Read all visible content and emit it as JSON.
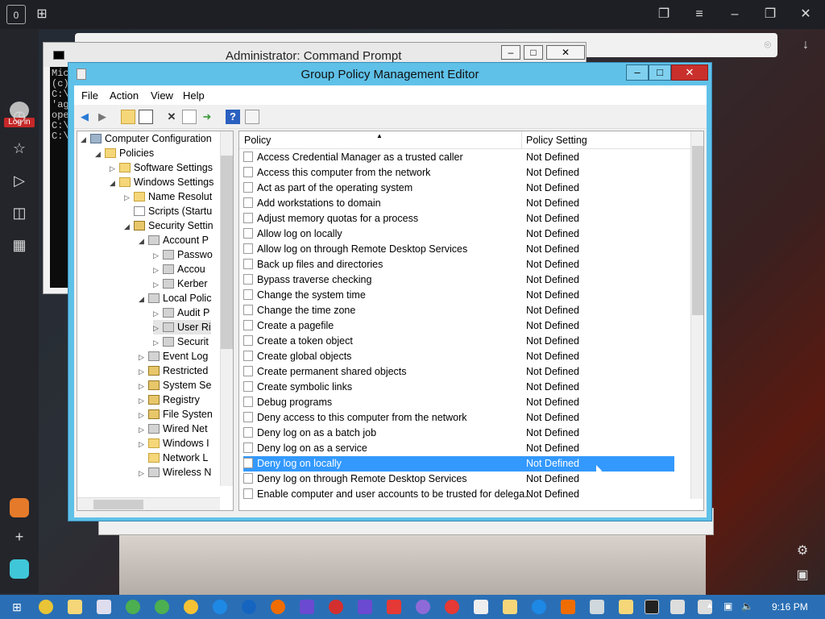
{
  "cmd_window": {
    "title": "Administrator: Command Prompt",
    "body_lines": [
      "Mic",
      "(c)",
      "",
      "C:\\",
      "'ag",
      "ope",
      "",
      "C:\\",
      "",
      "C:\\"
    ]
  },
  "browser": {
    "tab_count": "0",
    "login_label": "Log in"
  },
  "window": {
    "title": "Group Policy Management Editor",
    "menu": [
      "File",
      "Action",
      "View",
      "Help"
    ]
  },
  "tree": {
    "items": [
      {
        "label": "Computer Configuration",
        "icon": "computer-icon"
      },
      {
        "label": "Policies",
        "icon": "folder-icon"
      },
      {
        "label": "Software Settings",
        "icon": "folder-icon"
      },
      {
        "label": "Windows Settings",
        "icon": "folder-icon"
      },
      {
        "label": "Name Resolut",
        "icon": "folder-icon"
      },
      {
        "label": "Scripts (Startu",
        "icon": "document-icon"
      },
      {
        "label": "Security Settin",
        "icon": "lock-icon"
      },
      {
        "label": "Account P",
        "icon": "gear-icon"
      },
      {
        "label": "Passwo",
        "icon": "gear-icon"
      },
      {
        "label": "Accou",
        "icon": "gear-icon"
      },
      {
        "label": "Kerber",
        "icon": "gear-icon"
      },
      {
        "label": "Local Polic",
        "icon": "gear-icon"
      },
      {
        "label": "Audit P",
        "icon": "gear-icon"
      },
      {
        "label": "User Ri",
        "icon": "gear-icon"
      },
      {
        "label": "Securit",
        "icon": "gear-icon"
      },
      {
        "label": "Event Log",
        "icon": "gear-icon"
      },
      {
        "label": "Restricted",
        "icon": "lock-icon"
      },
      {
        "label": "System Se",
        "icon": "lock-icon"
      },
      {
        "label": "Registry",
        "icon": "lock-icon"
      },
      {
        "label": "File Systen",
        "icon": "lock-icon"
      },
      {
        "label": "Wired Net",
        "icon": "gear-icon"
      },
      {
        "label": "Windows I",
        "icon": "folder-icon"
      },
      {
        "label": "Network L",
        "icon": "folder-icon"
      },
      {
        "label": "Wireless N",
        "icon": "gear-icon"
      }
    ]
  },
  "list": {
    "col_policy": "Policy",
    "col_setting": "Policy Setting",
    "rows": [
      {
        "policy": "Access Credential Manager as a trusted caller",
        "setting": "Not Defined"
      },
      {
        "policy": "Access this computer from the network",
        "setting": "Not Defined"
      },
      {
        "policy": "Act as part of the operating system",
        "setting": "Not Defined"
      },
      {
        "policy": "Add workstations to domain",
        "setting": "Not Defined"
      },
      {
        "policy": "Adjust memory quotas for a process",
        "setting": "Not Defined"
      },
      {
        "policy": "Allow log on locally",
        "setting": "Not Defined"
      },
      {
        "policy": "Allow log on through Remote Desktop Services",
        "setting": "Not Defined"
      },
      {
        "policy": "Back up files and directories",
        "setting": "Not Defined"
      },
      {
        "policy": "Bypass traverse checking",
        "setting": "Not Defined"
      },
      {
        "policy": "Change the system time",
        "setting": "Not Defined"
      },
      {
        "policy": "Change the time zone",
        "setting": "Not Defined"
      },
      {
        "policy": "Create a pagefile",
        "setting": "Not Defined"
      },
      {
        "policy": "Create a token object",
        "setting": "Not Defined"
      },
      {
        "policy": "Create global objects",
        "setting": "Not Defined"
      },
      {
        "policy": "Create permanent shared objects",
        "setting": "Not Defined"
      },
      {
        "policy": "Create symbolic links",
        "setting": "Not Defined"
      },
      {
        "policy": "Debug programs",
        "setting": "Not Defined"
      },
      {
        "policy": "Deny access to this computer from the network",
        "setting": "Not Defined"
      },
      {
        "policy": "Deny log on as a batch job",
        "setting": "Not Defined"
      },
      {
        "policy": "Deny log on as a service",
        "setting": "Not Defined"
      },
      {
        "policy": "Deny log on locally",
        "setting": "Not Defined",
        "selected": true
      },
      {
        "policy": "Deny log on through Remote Desktop Services",
        "setting": "Not Defined"
      },
      {
        "policy": "Enable computer and user accounts to be trusted for delega...",
        "setting": "Not Defined"
      }
    ]
  },
  "taskbar": {
    "clock": "9:16 PM"
  }
}
